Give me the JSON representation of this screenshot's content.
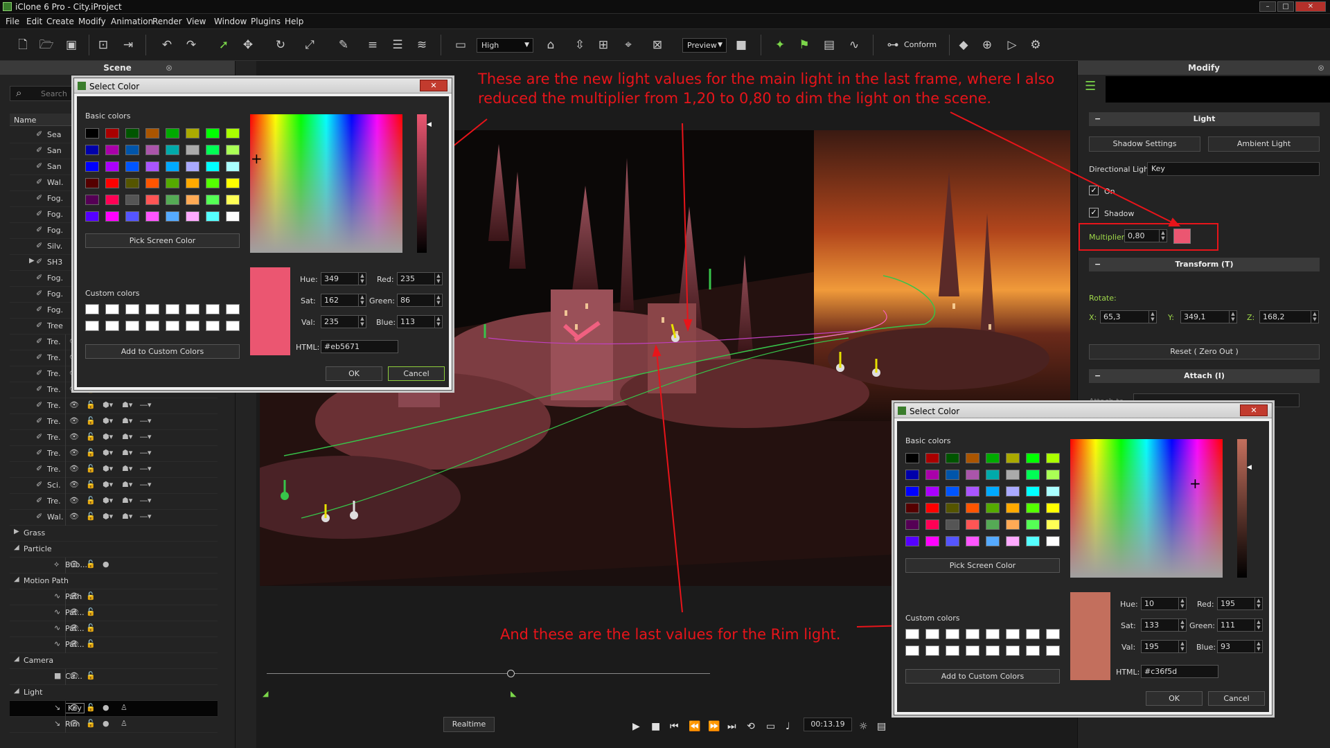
{
  "app": {
    "title": "iClone 6 Pro - City.iProject"
  },
  "menu": [
    "File",
    "Edit",
    "Create",
    "Modify",
    "Animation",
    "Render",
    "View",
    "Window",
    "Plugins",
    "Help"
  ],
  "toolbar": {
    "quality": "High",
    "preview": "Preview",
    "conform": "Conform"
  },
  "scene_panel": {
    "title": "Scene",
    "search_placeholder": "Search",
    "column_name": "Name",
    "items": [
      "Sea",
      "San",
      "San",
      "Wal.",
      "Fog.",
      "Fog.",
      "Fog.",
      "Silv.",
      "SH3",
      "Fog.",
      "Fog.",
      "Fog.",
      "Tree",
      "Tre.",
      "Tre.",
      "Tre.",
      "Tre.",
      "Tre.",
      "Tre.",
      "Tre.",
      "Tre.",
      "Tre.",
      "Sci.",
      "Tre.",
      "Wal."
    ],
    "groups": {
      "grass": "Grass",
      "particle": "Particle",
      "bubble": "Bub...",
      "motion_path": "Motion Path",
      "paths": [
        "Path",
        "Pat...",
        "Pat...",
        "Pat..."
      ],
      "camera": "Camera",
      "camera_item": "Ca...",
      "light": "Light",
      "lights": [
        "Key",
        "Rim"
      ]
    }
  },
  "timeline": {
    "realtime": "Realtime",
    "time": "00:13.19"
  },
  "modify_panel": {
    "title": "Modify",
    "light_section": "Light",
    "shadow_settings": "Shadow Settings",
    "ambient_light": "Ambient Light",
    "directional_light_label": "Directional Light",
    "directional_light_value": "Key",
    "on_label": "On",
    "shadow_label": "Shadow",
    "multiplier_label": "Multiplier",
    "multiplier_value": "0,80",
    "multiplier_color": "#eb5671",
    "transform_section": "Transform  (T)",
    "rotate_label": "Rotate:",
    "rot_x_label": "X:",
    "rot_x": "65,3",
    "rot_y_label": "Y:",
    "rot_y": "349,1",
    "rot_z_label": "Z:",
    "rot_z": "168,2",
    "reset": "Reset ( Zero Out )",
    "attach_section": "Attach  (I)",
    "attach_to": "Attach to"
  },
  "dialogs": {
    "main": {
      "title": "Select Color",
      "basic_colors": "Basic colors",
      "pick_screen": "Pick Screen Color",
      "custom_colors": "Custom colors",
      "add_custom": "Add to Custom Colors",
      "hue_label": "Hue:",
      "hue": "349",
      "sat_label": "Sat:",
      "sat": "162",
      "val_label": "Val:",
      "val": "235",
      "red_label": "Red:",
      "red": "235",
      "green_label": "Green:",
      "green": "86",
      "blue_label": "Blue:",
      "blue": "113",
      "html_label": "HTML:",
      "html": "#eb5671",
      "ok": "OK",
      "cancel": "Cancel",
      "color": "#eb5671"
    },
    "rim": {
      "title": "Select Color",
      "basic_colors": "Basic colors",
      "pick_screen": "Pick Screen Color",
      "custom_colors": "Custom colors",
      "add_custom": "Add to Custom Colors",
      "hue_label": "Hue:",
      "hue": "10",
      "sat_label": "Sat:",
      "sat": "133",
      "val_label": "Val:",
      "val": "195",
      "red_label": "Red:",
      "red": "195",
      "green_label": "Green:",
      "green": "111",
      "blue_label": "Blue:",
      "blue": "93",
      "html_label": "HTML:",
      "html": "#c36f5d",
      "ok": "OK",
      "cancel": "Cancel",
      "color": "#c36f5d"
    }
  },
  "basic_colors": [
    "#000000",
    "#aa0000",
    "#005500",
    "#aa5500",
    "#00aa00",
    "#aaaa00",
    "#00ff00",
    "#aaff00",
    "#0000aa",
    "#aa00aa",
    "#0055aa",
    "#aa55aa",
    "#00aaaa",
    "#aaaaaa",
    "#00ff55",
    "#aaff55",
    "#0000ff",
    "#aa00ff",
    "#0055ff",
    "#aa55ff",
    "#00aaff",
    "#aaaaff",
    "#00ffff",
    "#aaffff",
    "#550000",
    "#ff0000",
    "#555500",
    "#ff5500",
    "#55aa00",
    "#ffaa00",
    "#55ff00",
    "#ffff00",
    "#550055",
    "#ff0055",
    "#555555",
    "#ff5555",
    "#55aa55",
    "#ffaa55",
    "#55ff55",
    "#ffff55",
    "#5500ff",
    "#ff00ff",
    "#5555ff",
    "#ff55ff",
    "#55aaff",
    "#ffaaff",
    "#55ffff",
    "#ffffff"
  ],
  "annotations": {
    "top": "These are the new light values for the main light in the last frame, where I also reduced the multiplier from 1,20 to 0,80 to dim the light on the scene.",
    "bottom": "And these are the last values for the Rim light."
  }
}
